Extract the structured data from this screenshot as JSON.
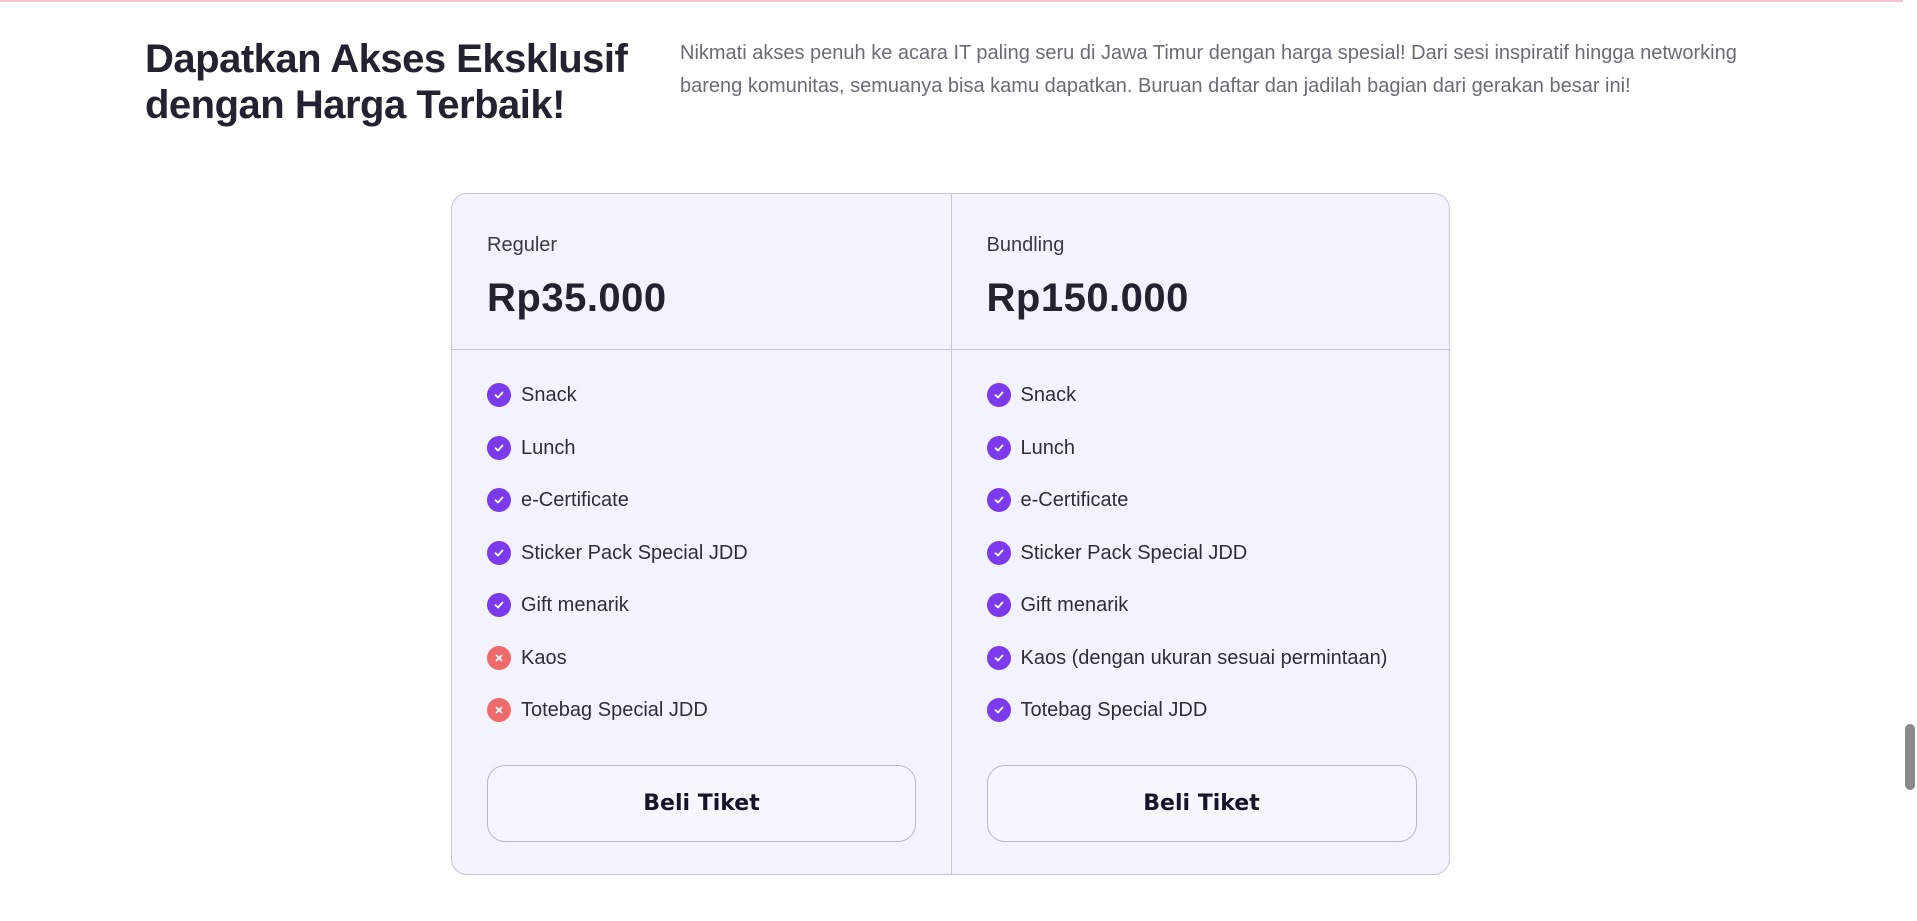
{
  "section": {
    "headline": "Dapatkan Akses Eksklusif dengan Harga Terbaik!",
    "intro": "Nikmati akses penuh ke acara IT paling seru di Jawa Timur dengan harga spesial! Dari sesi inspiratif hingga networking bareng komunitas, semuanya bisa kamu dapatkan. Buruan daftar dan jadilah bagian dari gerakan besar ini!"
  },
  "plans": [
    {
      "name": "Reguler",
      "price": "Rp35.000",
      "button_label": "Beli Tiket",
      "features": [
        {
          "label": "Snack",
          "included": true,
          "icon": "check-icon"
        },
        {
          "label": "Lunch",
          "included": true,
          "icon": "check-icon"
        },
        {
          "label": "e-Certificate",
          "included": true,
          "icon": "check-icon"
        },
        {
          "label": "Sticker Pack Special JDD",
          "included": true,
          "icon": "check-icon"
        },
        {
          "label": "Gift menarik",
          "included": true,
          "icon": "check-icon"
        },
        {
          "label": "Kaos",
          "included": false,
          "icon": "x-icon"
        },
        {
          "label": "Totebag Special JDD",
          "included": false,
          "icon": "x-icon"
        }
      ]
    },
    {
      "name": "Bundling",
      "price": "Rp150.000",
      "button_label": "Beli Tiket",
      "features": [
        {
          "label": "Snack",
          "included": true,
          "icon": "check-icon"
        },
        {
          "label": "Lunch",
          "included": true,
          "icon": "check-icon"
        },
        {
          "label": "e-Certificate",
          "included": true,
          "icon": "check-icon"
        },
        {
          "label": "Sticker Pack Special JDD",
          "included": true,
          "icon": "check-icon"
        },
        {
          "label": "Gift menarik",
          "included": true,
          "icon": "check-icon"
        },
        {
          "label": "Kaos (dengan ukuran sesuai permintaan)",
          "included": true,
          "icon": "check-icon"
        },
        {
          "label": "Totebag Special JDD",
          "included": true,
          "icon": "check-icon"
        }
      ]
    }
  ],
  "colors": {
    "accent": "#7c3aed",
    "excluded": "#ef6a6a",
    "card_bg": "#f3f3fd",
    "border": "#c6c6dd"
  }
}
